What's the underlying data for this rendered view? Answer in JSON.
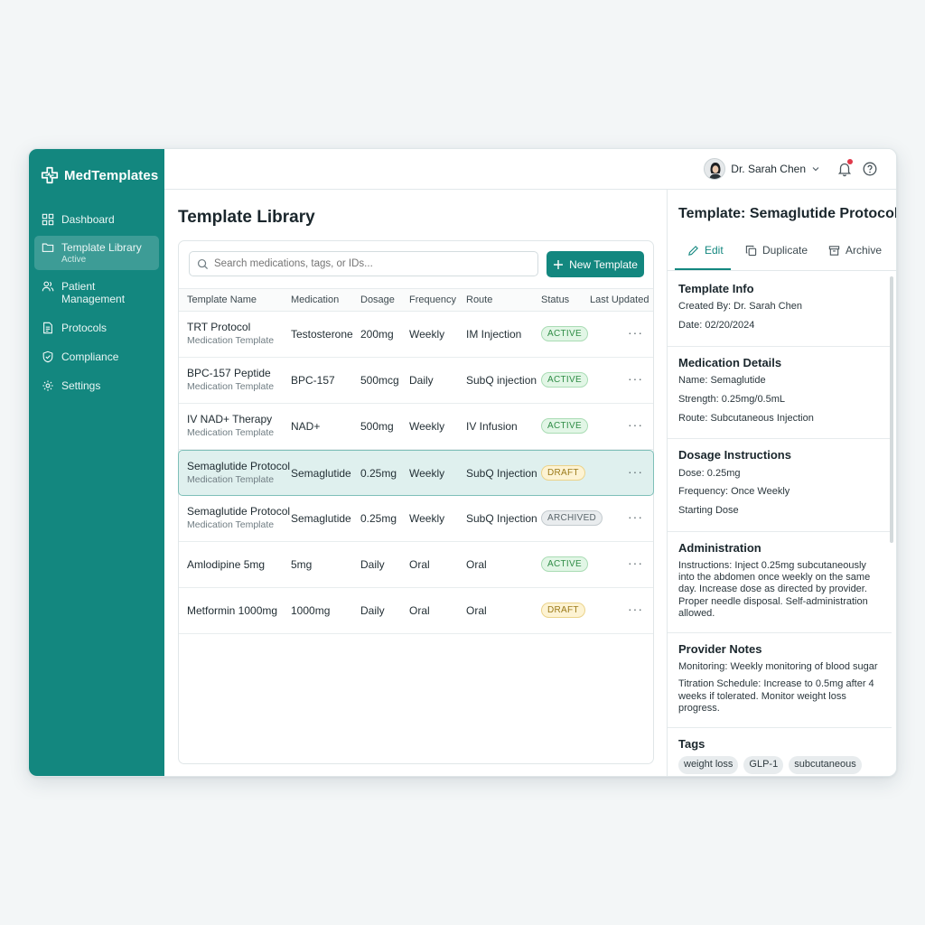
{
  "app": {
    "name": "MedTemplates"
  },
  "sidebar": {
    "items": [
      {
        "label": "Dashboard",
        "icon": "dashboard-icon"
      },
      {
        "label": "Template Library",
        "sub": "Active",
        "icon": "folder-icon"
      },
      {
        "label": "Patient Management",
        "icon": "users-icon"
      },
      {
        "label": "Protocols",
        "icon": "document-icon"
      },
      {
        "label": "Compliance",
        "icon": "shield-icon"
      },
      {
        "label": "Settings",
        "icon": "gear-icon"
      }
    ]
  },
  "topbar": {
    "user_name": "Dr. Sarah Chen"
  },
  "main": {
    "title": "Template Library",
    "search_placeholder": "Search medications, tags, or IDs...",
    "new_button": "New Template",
    "columns": [
      "Template Name",
      "Medication",
      "Dosage",
      "Frequency",
      "Route",
      "Status",
      "Last Updated"
    ],
    "rows": [
      {
        "name": "TRT Protocol",
        "sub": "Medication Template",
        "medication": "Testosterone",
        "dosage": "200mg",
        "frequency": "Weekly",
        "route": "IM Injection",
        "status": "ACTIVE"
      },
      {
        "name": "BPC-157 Peptide",
        "sub": "Medication Template",
        "medication": "BPC-157",
        "dosage": "500mcg",
        "frequency": "Daily",
        "route": "SubQ injection",
        "status": "ACTIVE"
      },
      {
        "name": "IV NAD+ Therapy",
        "sub": "Medication Template",
        "medication": "NAD+",
        "dosage": "500mg",
        "frequency": "Weekly",
        "route": "IV Infusion",
        "status": "ACTIVE"
      },
      {
        "name": "Semaglutide Protocol",
        "sub": "Medication Template",
        "medication": "Semaglutide",
        "dosage": "0.25mg",
        "frequency": "Weekly",
        "route": "SubQ Injection",
        "status": "DRAFT"
      },
      {
        "name": "Semaglutide Protocol",
        "sub": "Medication Template",
        "medication": "Semaglutide",
        "dosage": "0.25mg",
        "frequency": "Weekly",
        "route": "SubQ Injection",
        "status": "ARCHIVED"
      },
      {
        "name": "Amlodipine 5mg",
        "sub": "",
        "medication": "5mg",
        "dosage": "Daily",
        "frequency": "Oral",
        "route": "Oral",
        "status": "ACTIVE"
      },
      {
        "name": "Metformin 1000mg",
        "sub": "",
        "medication": "1000mg",
        "dosage": "Daily",
        "frequency": "Oral",
        "route": "Oral",
        "status": "DRAFT"
      }
    ],
    "row_action": "···"
  },
  "panel": {
    "title": "Template: Semaglutide Protocol",
    "tabs": {
      "edit": "Edit",
      "duplicate": "Duplicate",
      "archive": "Archive"
    },
    "template_info": {
      "heading": "Template Info",
      "created_by": "Created By: Dr. Sarah Chen",
      "date": "Date: 02/20/2024"
    },
    "medication_details": {
      "heading": "Medication Details",
      "name": "Name: Semaglutide",
      "strength": "Strength: 0.25mg/0.5mL",
      "route": "Route: Subcutaneous Injection"
    },
    "dosage_instructions": {
      "heading": "Dosage Instructions",
      "dose": "Dose: 0.25mg",
      "frequency": "Frequency: Once Weekly",
      "starting": "Starting Dose"
    },
    "administration": {
      "heading": "Administration",
      "text": "Instructions: Inject 0.25mg subcutaneously into the abdomen once weekly on the same day. Increase dose as directed by provider. Proper needle disposal. Self-administration allowed."
    },
    "provider_notes": {
      "heading": "Provider Notes",
      "monitoring": "Monitoring: Weekly monitoring of blood sugar",
      "titration": "Titration Schedule: Increase to 0.5mg after 4 weeks if tolerated. Monitor weight loss progress."
    },
    "tags": {
      "heading": "Tags",
      "items": [
        "weight loss",
        "GLP-1",
        "subcutaneous"
      ]
    }
  },
  "colors": {
    "brand": "#13877f",
    "active_badge": "#2f8c46",
    "draft_badge": "#9b7a1a",
    "archived_badge": "#5b666b",
    "notification_dot": "#e0394a"
  }
}
